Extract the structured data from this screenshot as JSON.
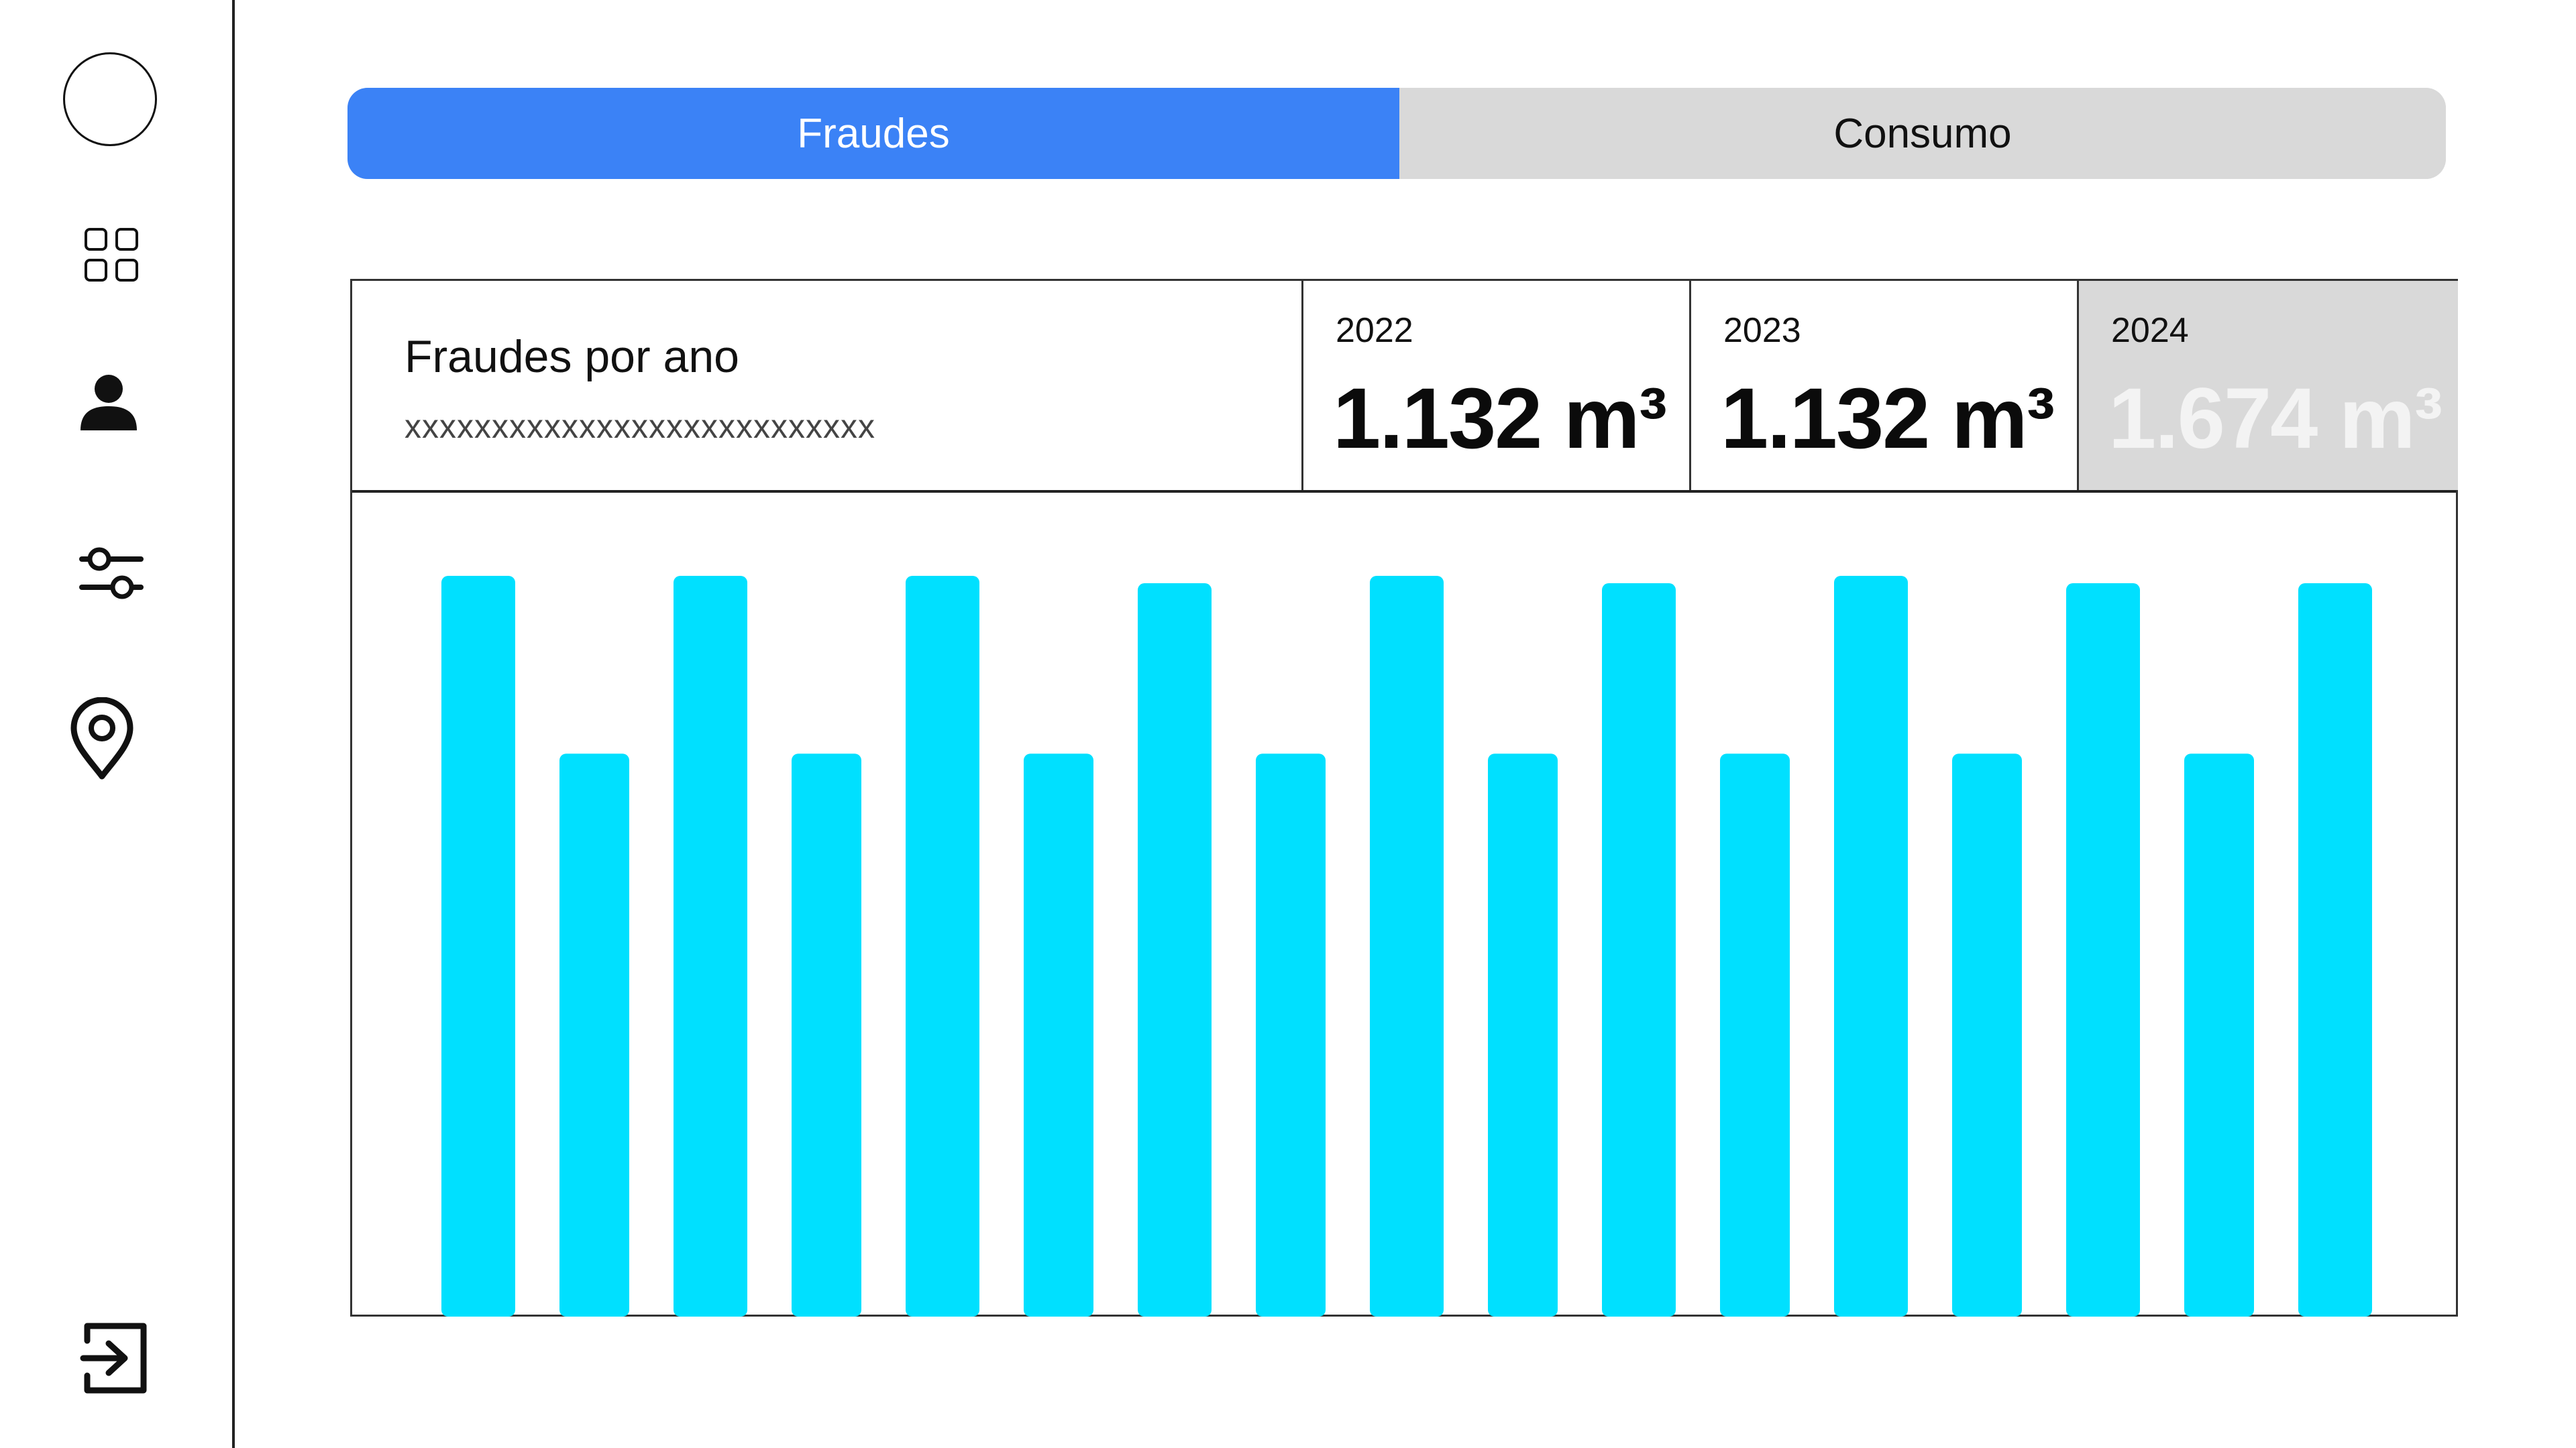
{
  "sidebar": {
    "icons": [
      "avatar",
      "grid-icon",
      "user-icon",
      "sliders-icon",
      "location-pin-icon",
      "logout-icon"
    ]
  },
  "tabs": [
    {
      "label": "Fraudes",
      "active": true
    },
    {
      "label": "Consumo",
      "active": false
    }
  ],
  "panel": {
    "title": "Fraudes por ano",
    "subtitle": "xxxxxxxxxxxxxxxxxxxxxxxxxxx",
    "years": [
      {
        "year": "2022",
        "value": "1.132 m³",
        "selected": false
      },
      {
        "year": "2023",
        "value": "1.132 m³",
        "selected": false
      },
      {
        "year": "2024",
        "value": "1.674 m³",
        "selected": true
      }
    ]
  },
  "colors": {
    "accent": "#3b82f6",
    "bar": "#00e0ff",
    "inactive_tab": "#d9d9d9",
    "selected_card": "#d9d9d9"
  },
  "chart_data": {
    "type": "bar",
    "ylim": [
      0,
      100
    ],
    "series": [
      {
        "values": [
          100,
          76,
          100,
          76,
          100,
          76,
          99,
          76,
          100,
          76,
          99,
          76,
          100,
          76,
          99,
          76,
          99
        ]
      }
    ]
  }
}
